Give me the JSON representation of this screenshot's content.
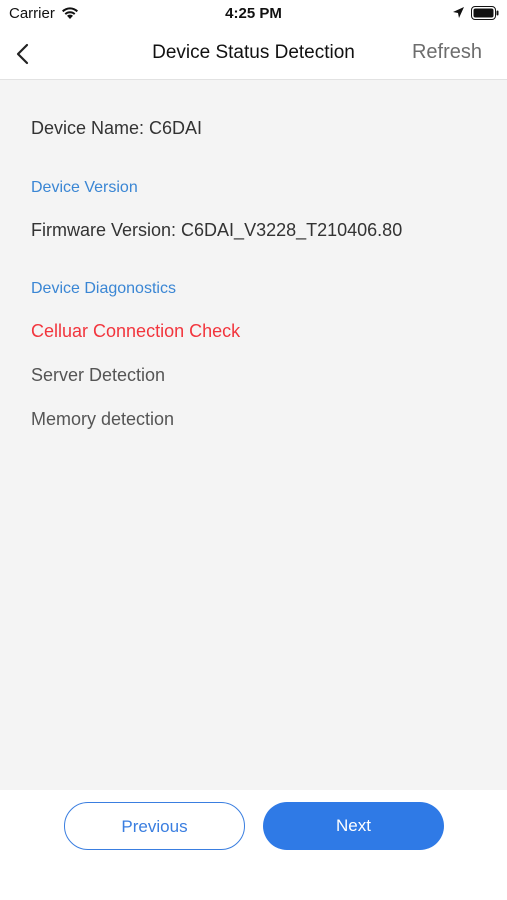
{
  "status_bar": {
    "carrier": "Carrier",
    "time": "4:25 PM",
    "icons": [
      "wifi-icon",
      "location-icon",
      "battery-icon"
    ]
  },
  "nav": {
    "title": "Device Status Detection",
    "refresh_label": "Refresh",
    "back_icon": "chevron-left-icon"
  },
  "device": {
    "name_line": "Device Name: C6DAI"
  },
  "version_section": {
    "header": "Device Version",
    "firmware_line": "Firmware Version: C6DAI_V3228_T210406.80"
  },
  "diagnostics_section": {
    "header": "Device Diagonostics",
    "items": [
      {
        "label": "Celluar Connection Check",
        "status_color": "#f2353d"
      },
      {
        "label": "Server Detection"
      },
      {
        "label": "Memory detection"
      }
    ]
  },
  "footer": {
    "previous_label": "Previous",
    "next_label": "Next"
  },
  "colors": {
    "accent": "#2f7ae6",
    "section_header": "#3a86d4",
    "error": "#f2353d",
    "content_bg": "#f4f4f4"
  }
}
